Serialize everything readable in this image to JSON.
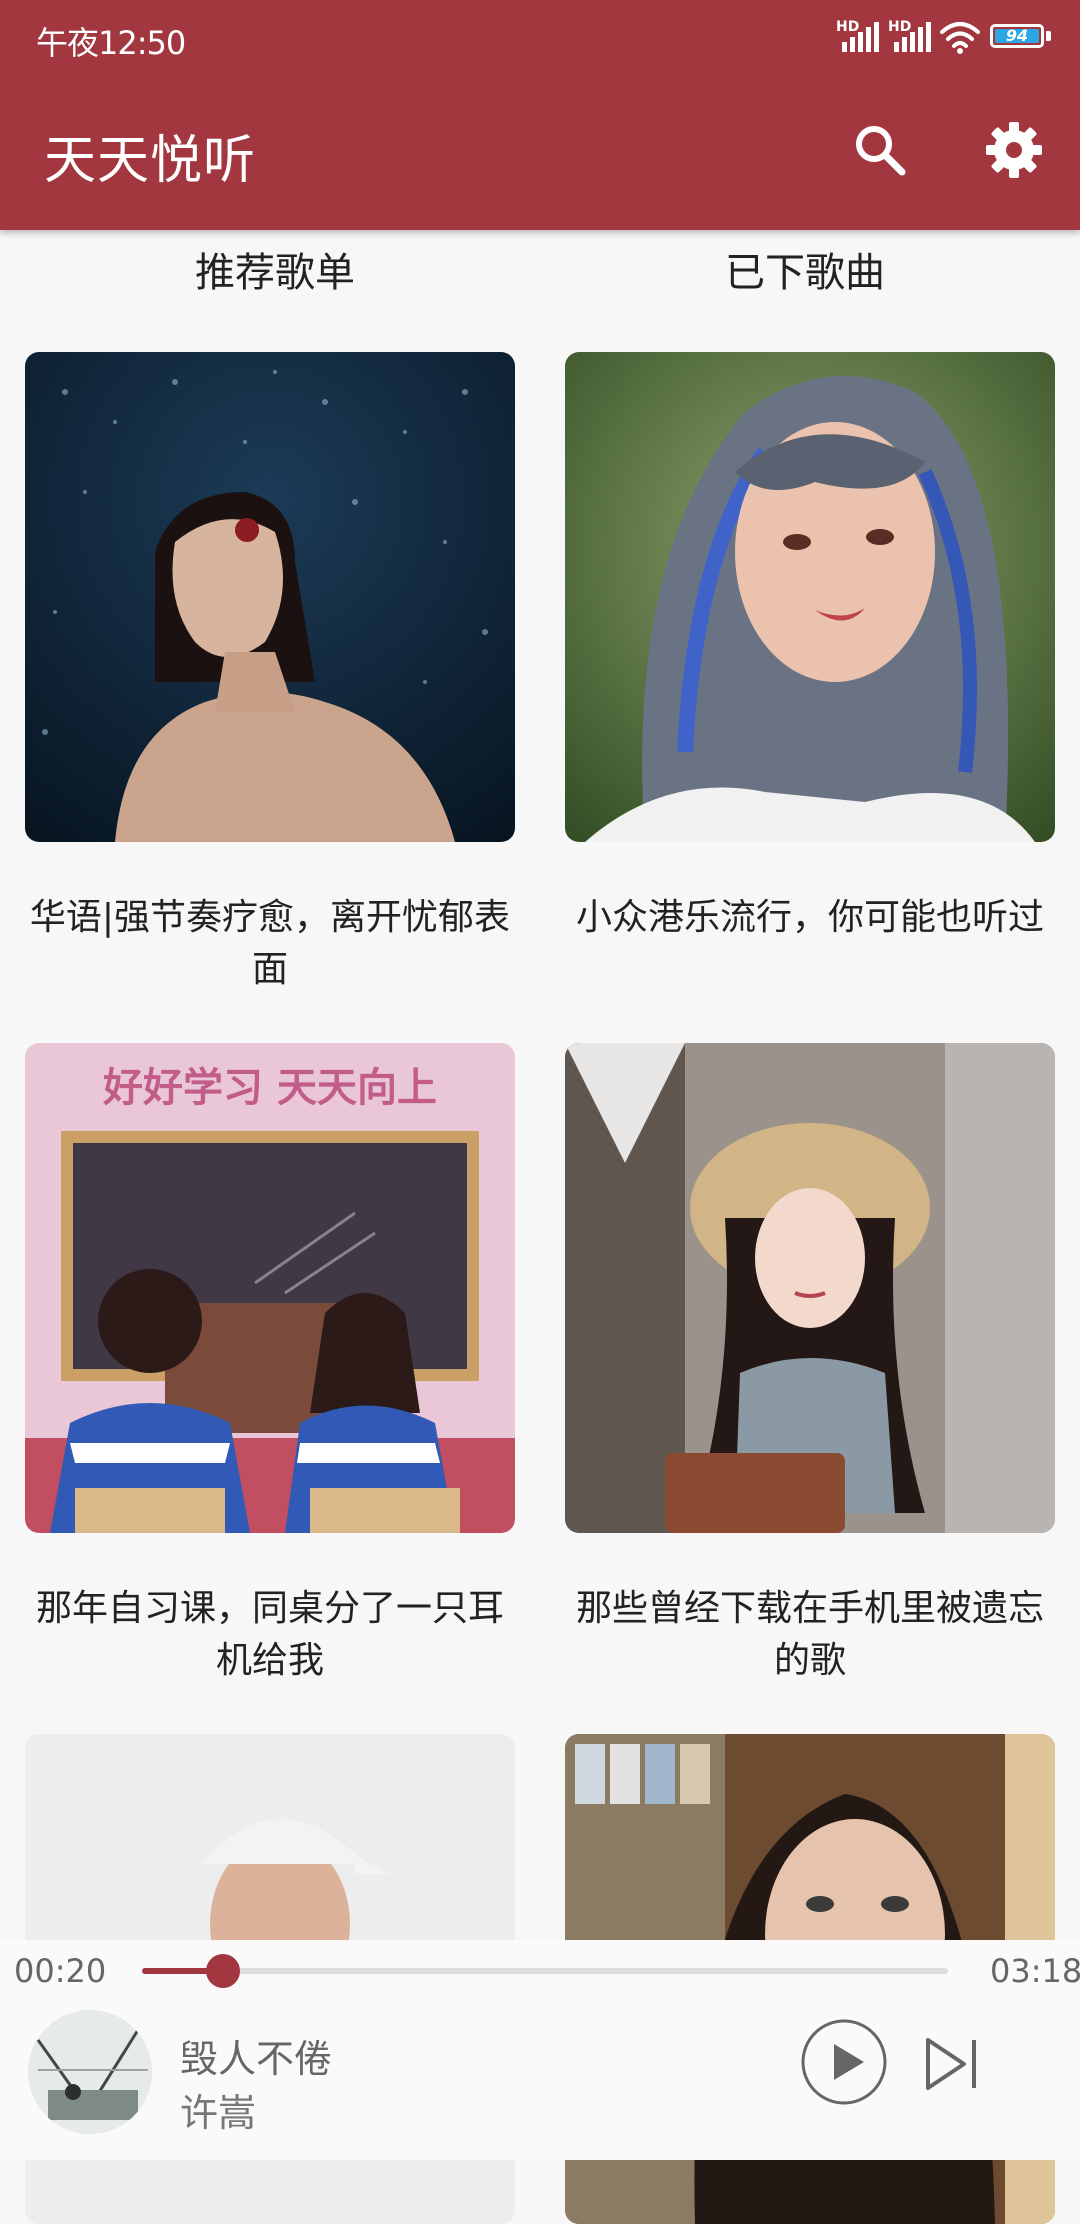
{
  "status": {
    "time": "午夜12:50",
    "battery": "94",
    "signal_1": "HD",
    "signal_2": "HD"
  },
  "header": {
    "title": "天天悦听",
    "search_icon": "search-icon",
    "settings_icon": "gear-icon"
  },
  "tabs": [
    {
      "label": "推荐歌单"
    },
    {
      "label": "已下歌曲"
    }
  ],
  "playlists": [
    {
      "title": "华语|强节奏疗愈，离开忧郁表面"
    },
    {
      "title": "小众港乐流行，你可能也听过"
    },
    {
      "title": "那年自习课，同桌分了一只耳机给我",
      "cover_text": "好好学习 天天向上"
    },
    {
      "title": "那些曾经下载在手机里被遗忘的歌"
    }
  ],
  "player": {
    "current_time": "00:20",
    "total_time": "03:18",
    "progress": 0.1,
    "song": "毁人不倦",
    "artist": "许嵩",
    "accent_color": "#a23740"
  }
}
